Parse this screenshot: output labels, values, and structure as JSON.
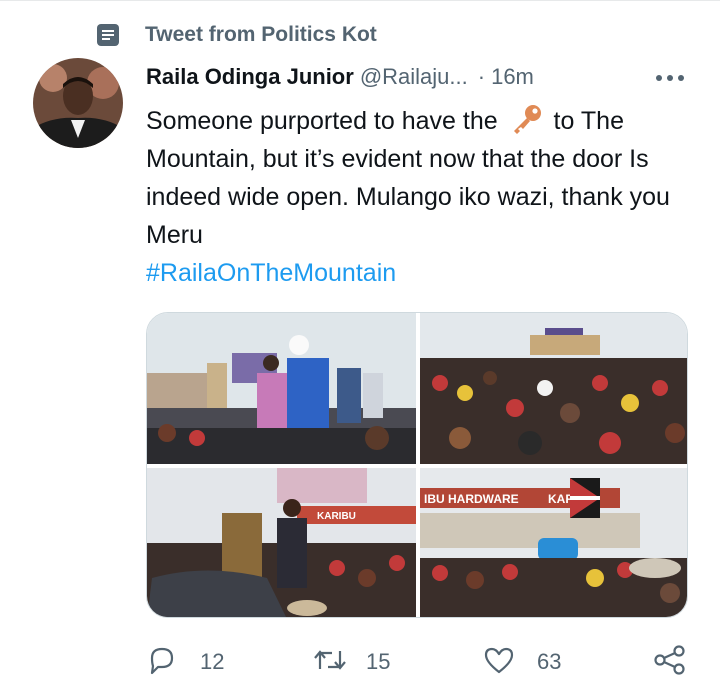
{
  "context": {
    "label": "Tweet from Politics Kot",
    "icon": "document-icon"
  },
  "tweet": {
    "author_name": "Raila Odinga Junior",
    "handle": "@Railaju...",
    "separator": "·",
    "time": "16m",
    "text_before_emoji": "Someone purported to have the",
    "emoji": "key-emoji",
    "text_after_emoji": "to The Mountain, but it’s evident now that the door Is indeed wide open. Mulango iko wazi, thank you Meru",
    "hashtag": "#RailaOnTheMountain",
    "photos": [
      {
        "name": "rally-photo-1"
      },
      {
        "name": "rally-photo-2"
      },
      {
        "name": "rally-photo-3",
        "sign_text": "KARIBU"
      },
      {
        "name": "rally-photo-4",
        "sign_text": "IBU HARDWARE",
        "sign_text_2": "KAR"
      }
    ]
  },
  "actions": {
    "reply": {
      "icon": "reply-icon",
      "count": "12"
    },
    "retweet": {
      "icon": "retweet-icon",
      "count": "15"
    },
    "like": {
      "icon": "heart-icon",
      "count": "63"
    },
    "share": {
      "icon": "share-icon"
    }
  },
  "colors": {
    "accent": "#1d9bf0",
    "secondary_text": "#536471",
    "primary_text": "#0f1419"
  }
}
